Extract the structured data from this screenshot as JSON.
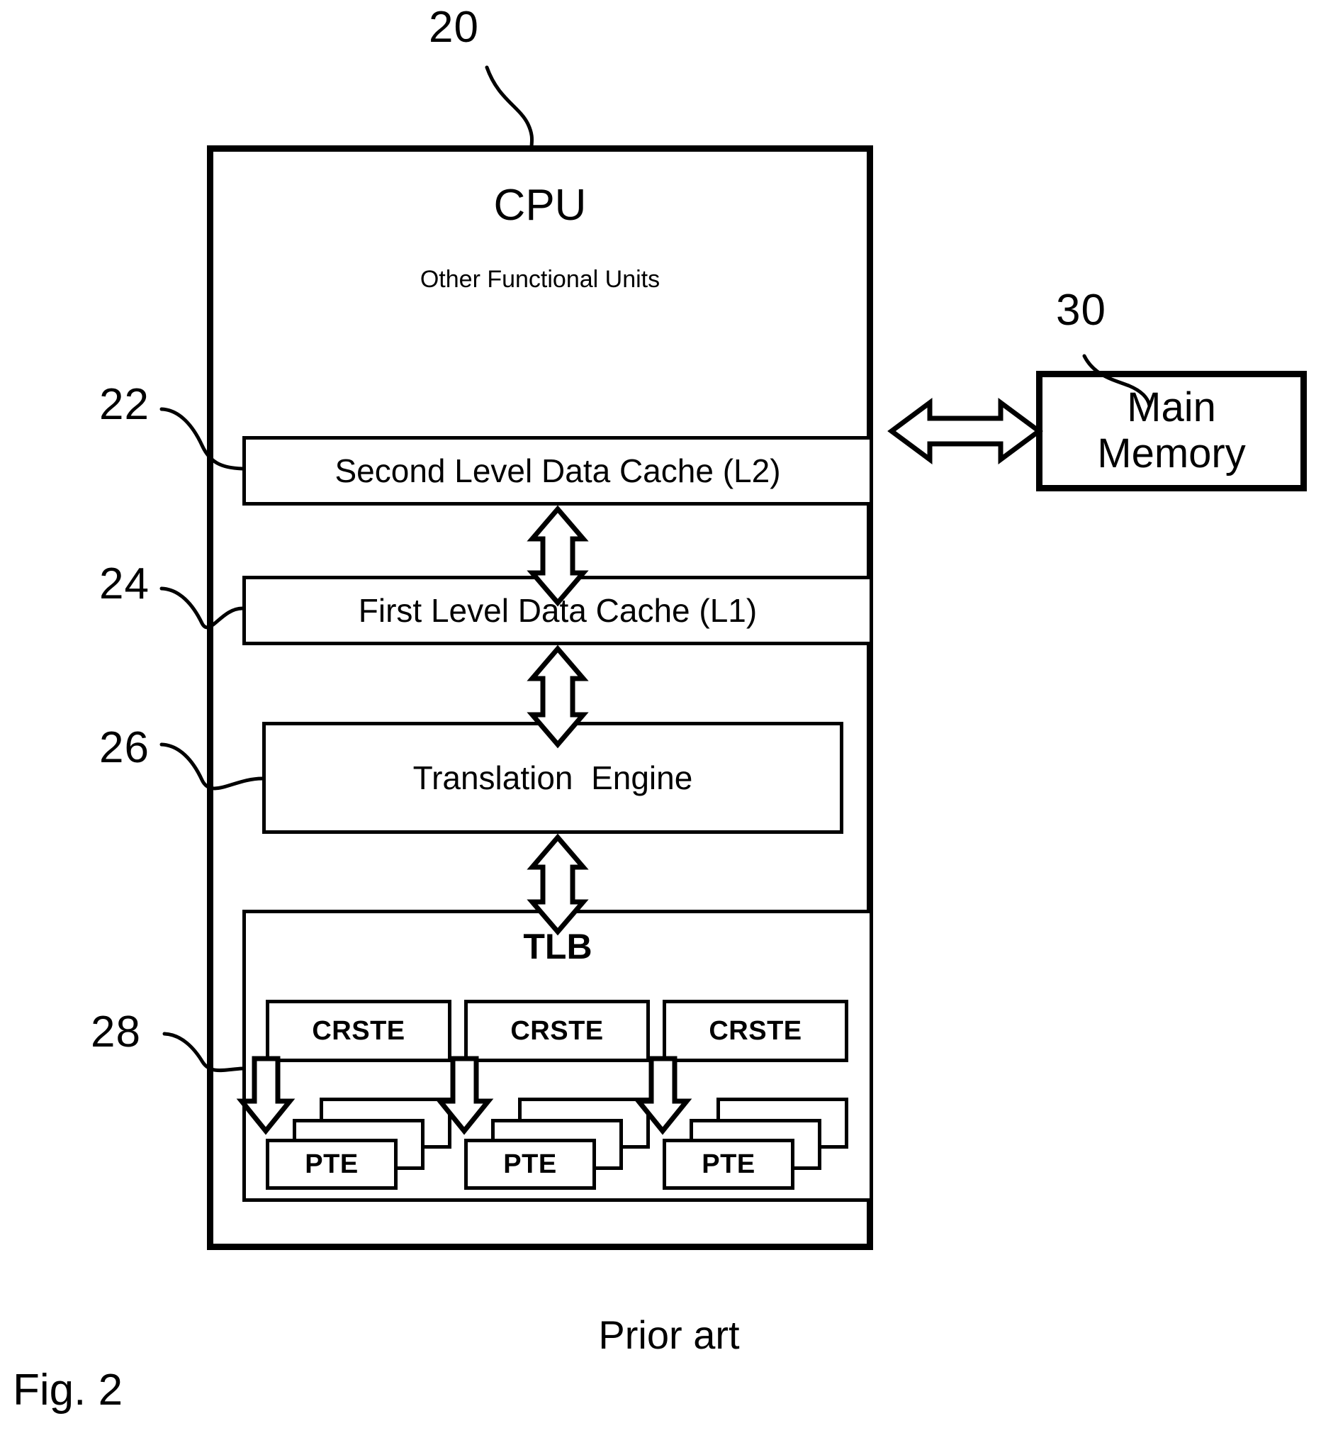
{
  "figure": {
    "label": "Fig. 2",
    "note": "Prior art"
  },
  "cpu": {
    "title": "CPU",
    "subtitle": "Other Functional Units",
    "ref": "20"
  },
  "main_memory": {
    "line1": "Main",
    "line2": "Memory",
    "ref": "30"
  },
  "units": [
    {
      "label": "Second Level Data Cache (L2)",
      "ref": "22"
    },
    {
      "label": "First Level Data Cache (L1)",
      "ref": "24"
    },
    {
      "label": "Translation  Engine",
      "ref": "26"
    }
  ],
  "tlb": {
    "title": "TLB",
    "ref": "28",
    "columns": [
      {
        "crste": "CRSTE",
        "pte": "PTE"
      },
      {
        "crste": "CRSTE",
        "pte": "PTE"
      },
      {
        "crste": "CRSTE",
        "pte": "PTE"
      }
    ]
  },
  "connectors": {
    "l2_to_memory": "double-headed-horizontal-arrow",
    "l2_to_l1": "double-headed-vertical-arrow",
    "l1_to_te": "double-headed-vertical-arrow",
    "te_to_tlb": "double-headed-vertical-arrow",
    "crste_to_pte": "down-block-arrow"
  },
  "style": {
    "stroke": "#000000",
    "background": "#ffffff"
  }
}
